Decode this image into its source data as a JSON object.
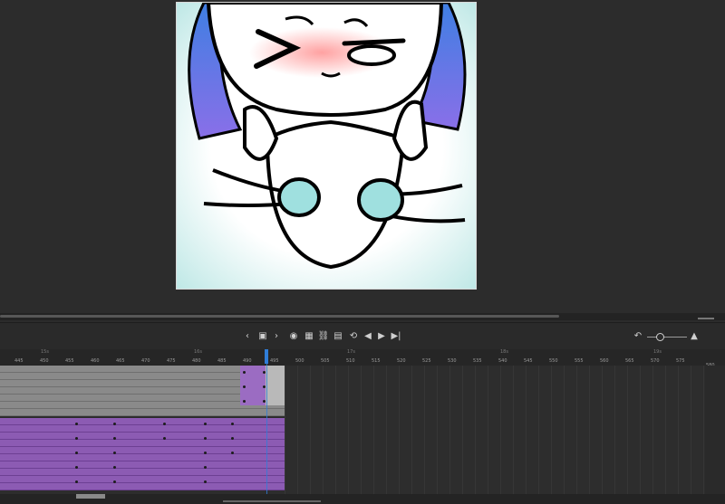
{
  "timeline": {
    "ruler_labels": [
      "445",
      "450",
      "455",
      "460",
      "465",
      "470",
      "475",
      "480",
      "485",
      "490",
      "495",
      "500",
      "505",
      "510",
      "515",
      "520",
      "525",
      "530",
      "535",
      "540",
      "545",
      "550",
      "555",
      "560",
      "565",
      "570",
      "575"
    ],
    "second_marks": [
      "15s",
      "16s",
      "17s",
      "18s",
      "19s"
    ],
    "current_frame_end": "580",
    "controls": {
      "prev_label": "‹",
      "next_label": "›",
      "play_label": "▶",
      "step_back_label": "◀",
      "step_fwd_label": "▶|",
      "loop_label": "⟲"
    }
  },
  "colors": {
    "purple_track": "#8c5bb3",
    "gray_track": "#8a8a8a",
    "playhead": "#2f7dd8"
  }
}
